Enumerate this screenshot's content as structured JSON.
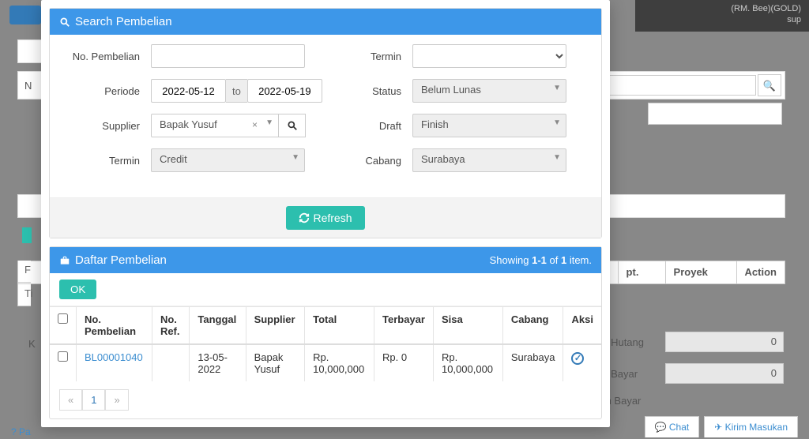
{
  "bg": {
    "user_line1": "(RM. Bee)(GOLD)",
    "user_line2": "sup",
    "th_dept": "pt.",
    "th_proyek": "Proyek",
    "th_action": "Action",
    "row1": "F",
    "row2": "Ti",
    "totals": {
      "hutang_label": "Total Hutang",
      "hutang_val": "0",
      "bayar_label": "Total Bayar",
      "bayar_val": "0",
      "lebih_label": "Lebih Bayar"
    },
    "footer_help": "? Pa",
    "chat": "Chat",
    "kirim": "Kirim Masukan"
  },
  "search": {
    "title": "Search Pembelian",
    "labels": {
      "no": "No. Pembelian",
      "periode": "Periode",
      "supplier": "Supplier",
      "termin_left": "Termin",
      "termin_right": "Termin",
      "status": "Status",
      "draft": "Draft",
      "cabang": "Cabang"
    },
    "values": {
      "periode_from": "2022-05-12",
      "periode_to_label": "to",
      "periode_to": "2022-05-19",
      "supplier": "Bapak Yusuf",
      "termin": "Credit",
      "status": "Belum Lunas",
      "draft": "Finish",
      "cabang": "Surabaya"
    },
    "refresh": "Refresh"
  },
  "list": {
    "title": "Daftar Pembelian",
    "showing_prefix": "Showing ",
    "showing_range": "1-1",
    "showing_mid": " of ",
    "showing_total": "1",
    "showing_suffix": " item.",
    "ok": "OK",
    "headers": {
      "no": "No. Pembelian",
      "ref": "No. Ref.",
      "tanggal": "Tanggal",
      "supplier": "Supplier",
      "total": "Total",
      "terbayar": "Terbayar",
      "sisa": "Sisa",
      "cabang": "Cabang",
      "aksi": "Aksi"
    },
    "rows": [
      {
        "no": "BL00001040",
        "ref": "",
        "tanggal": "13-05-2022",
        "supplier": "Bapak Yusuf",
        "total": "Rp. 10,000,000",
        "terbayar": "Rp. 0",
        "sisa": "Rp. 10,000,000",
        "cabang": "Surabaya"
      }
    ],
    "pager": {
      "prev": "«",
      "page": "1",
      "next": "»"
    }
  }
}
